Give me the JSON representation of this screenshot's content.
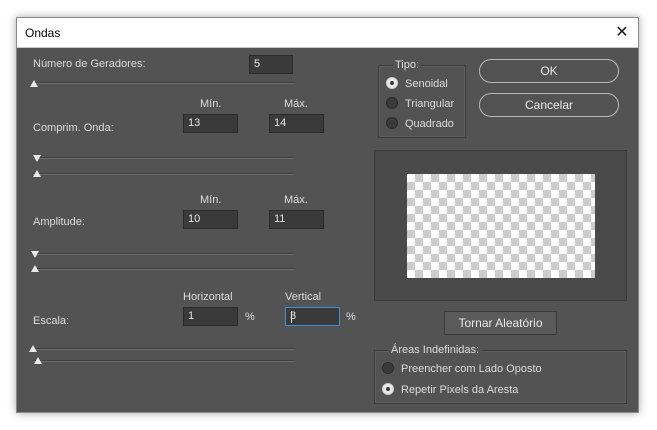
{
  "window": {
    "title": "Ondas",
    "close_glyph": "✕"
  },
  "generators": {
    "label": "Número de Geradores:",
    "value": "5",
    "slider": 0.0
  },
  "wavelength": {
    "label": "Comprim. Onda:",
    "min_header": "Mín.",
    "max_header": "Máx.",
    "min_value": "13",
    "max_value": "14"
  },
  "amplitude": {
    "label": "Amplitude:",
    "min_header": "Mín.",
    "max_header": "Máx.",
    "min_value": "10",
    "max_value": "11"
  },
  "scale": {
    "label": "Escala:",
    "horizontal_header": "Horizontal",
    "vertical_header": "Vertical",
    "horizontal_value": "1",
    "vertical_value": "3",
    "unit": "%"
  },
  "type_group": {
    "title": "Tipo:",
    "options": [
      {
        "label": "Senoidal",
        "checked": true
      },
      {
        "label": "Triangular",
        "checked": false
      },
      {
        "label": "Quadrado",
        "checked": false
      }
    ]
  },
  "buttons": {
    "ok": "OK",
    "cancel": "Cancelar",
    "randomize": "Tornar Aleatório"
  },
  "undefined_areas": {
    "title": "Áreas Indefinidas:",
    "options": [
      {
        "label": "Preencher com Lado Oposto",
        "checked": false
      },
      {
        "label": "Repetir Pixels da Aresta",
        "checked": true
      }
    ]
  },
  "colors": {
    "dialog_bg": "#535353",
    "field_bg": "#3a3a3a",
    "focus": "#3f8fd8"
  }
}
